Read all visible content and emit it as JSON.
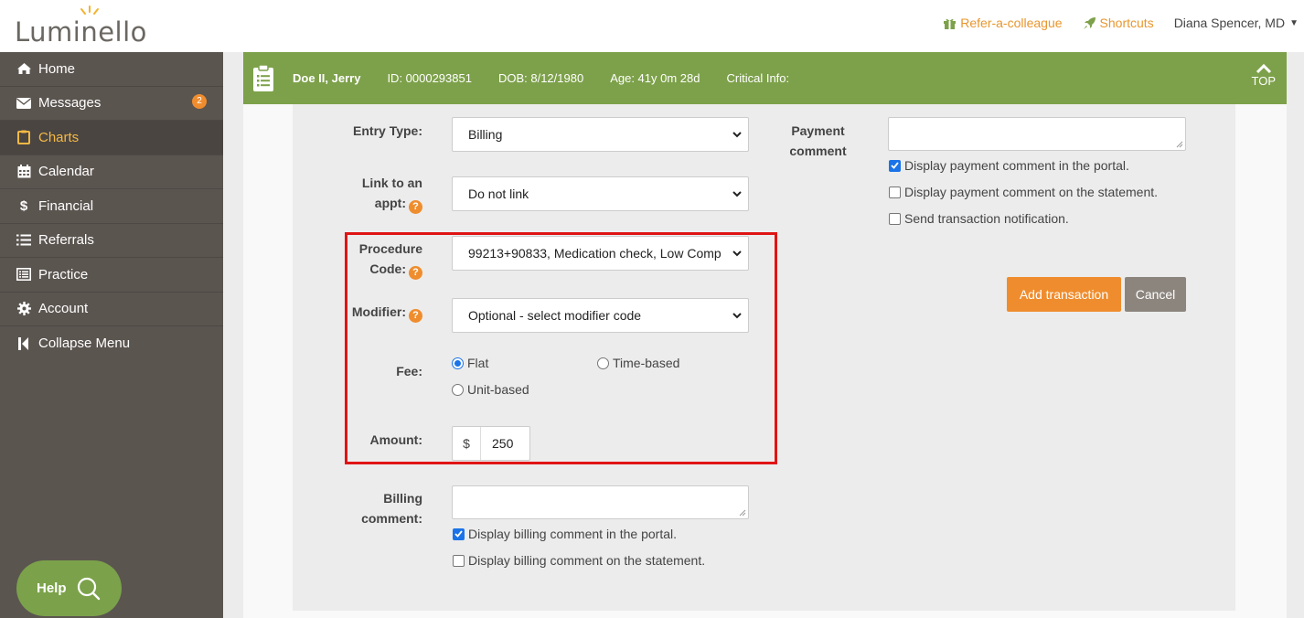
{
  "app": {
    "logo_text": "Luminello"
  },
  "header": {
    "refer_label": "Refer-a-colleague",
    "shortcuts_label": "Shortcuts",
    "user_name": "Diana Spencer, MD"
  },
  "sidebar": {
    "items": [
      {
        "label": "Home",
        "icon": "home-icon"
      },
      {
        "label": "Messages",
        "icon": "envelope-icon",
        "badge": "2"
      },
      {
        "label": "Charts",
        "icon": "clipboard-icon",
        "active": true
      },
      {
        "label": "Calendar",
        "icon": "calendar-icon"
      },
      {
        "label": "Financial",
        "icon": "dollar-icon"
      },
      {
        "label": "Referrals",
        "icon": "list-icon"
      },
      {
        "label": "Practice",
        "icon": "practice-icon"
      },
      {
        "label": "Account",
        "icon": "gear-icon"
      },
      {
        "label": "Collapse Menu",
        "icon": "collapse-icon"
      }
    ],
    "help_label": "Help"
  },
  "patient": {
    "name": "Doe II, Jerry",
    "id": "ID: 0000293851",
    "dob": "DOB: 8/12/1980",
    "age": "Age: 41y 0m 28d",
    "critical": "Critical Info:",
    "top_label": "TOP"
  },
  "form": {
    "entry_type_label": "Entry Type:",
    "entry_type_value": "Billing",
    "link_label_1": "Link to an",
    "link_label_2": "appt:",
    "link_value": "Do not link",
    "procedure_label_1": "Procedure",
    "procedure_label_2": "Code:",
    "procedure_value": "99213+90833, Medication check, Low Comp",
    "modifier_label": "Modifier:",
    "modifier_value": "Optional - select modifier code",
    "fee_label": "Fee:",
    "fee_options": [
      "Flat",
      "Time-based",
      "Unit-based"
    ],
    "fee_selected": "Flat",
    "amount_label": "Amount:",
    "amount_currency": "$",
    "amount_value": "250",
    "billing_comment_label_1": "Billing",
    "billing_comment_label_2": "comment:",
    "billing_checks": [
      {
        "label": "Display billing comment in the portal.",
        "checked": true
      },
      {
        "label": "Display billing comment on the statement.",
        "checked": false
      }
    ],
    "payment_comment_label_1": "Payment",
    "payment_comment_label_2": "comment",
    "payment_checks": [
      {
        "label": "Display payment comment in the portal.",
        "checked": true
      },
      {
        "label": "Display payment comment on the statement.",
        "checked": false
      },
      {
        "label": "Send transaction notification.",
        "checked": false
      }
    ],
    "add_button": "Add transaction",
    "cancel_button": "Cancel"
  },
  "colors": {
    "accent_orange": "#ef8d2e",
    "brand_green": "#7da14a",
    "sidebar_bg": "#5b5550",
    "active_nav": "#f5b945",
    "highlight_red": "#e01414"
  }
}
